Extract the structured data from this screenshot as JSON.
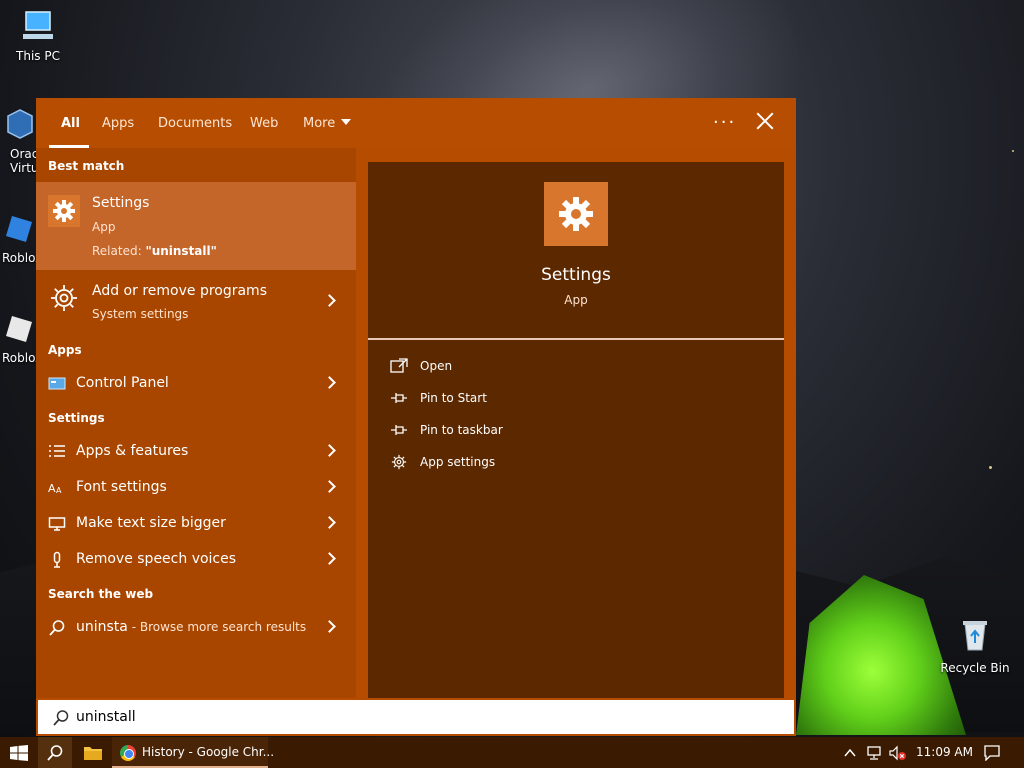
{
  "desktop": {
    "icons": [
      {
        "label": "This PC"
      },
      {
        "label": "Orac"
      },
      {
        "label": "Virtu"
      },
      {
        "label": "Roblox"
      },
      {
        "label": "Roblox"
      },
      {
        "label": "Recycle Bin"
      }
    ]
  },
  "search_panel": {
    "tabs": [
      {
        "label": "All",
        "active": true
      },
      {
        "label": "Apps"
      },
      {
        "label": "Documents"
      },
      {
        "label": "Web"
      },
      {
        "label": "More"
      }
    ],
    "more_options_icon": "ellipsis-icon",
    "close_icon": "close-icon",
    "best_match": {
      "section_title": "Best match",
      "name": "Settings",
      "type": "App",
      "related_prefix": "Related: ",
      "related_term": "\"uninstall\"",
      "icon": "gear-icon"
    },
    "add_remove": {
      "name": "Add or remove programs",
      "sub": "System settings",
      "icon": "gear-outline-icon"
    },
    "apps_section": {
      "title": "Apps",
      "items": [
        {
          "label": "Control Panel",
          "icon": "control-panel-icon"
        }
      ]
    },
    "settings_section": {
      "title": "Settings",
      "items": [
        {
          "label": "Apps & features",
          "icon": "list-icon"
        },
        {
          "label": "Font settings",
          "icon": "font-icon"
        },
        {
          "label": "Make text size bigger",
          "icon": "monitor-icon"
        },
        {
          "label": "Remove speech voices",
          "icon": "microphone-icon"
        }
      ]
    },
    "web_section": {
      "title": "Search the web",
      "query": "uninsta",
      "suffix": " - Browse more search results",
      "icon": "search-icon"
    },
    "preview": {
      "name": "Settings",
      "type": "App",
      "actions": [
        {
          "label": "Open",
          "icon": "open-icon"
        },
        {
          "label": "Pin to Start",
          "icon": "pin-icon"
        },
        {
          "label": "Pin to taskbar",
          "icon": "pin-icon"
        },
        {
          "label": "App settings",
          "icon": "gear-icon"
        }
      ]
    },
    "search_box": {
      "value": "uninstall",
      "icon": "search-icon"
    }
  },
  "taskbar": {
    "start_icon": "windows-icon",
    "search_icon": "search-icon",
    "explorer_icon": "folder-icon",
    "chrome_label": "History - Google Chr...",
    "tray": {
      "chevron": "^",
      "time": "11:09 AM"
    },
    "colors": {
      "taskbar": "#3a1a00",
      "accent": "#b54c00"
    }
  }
}
